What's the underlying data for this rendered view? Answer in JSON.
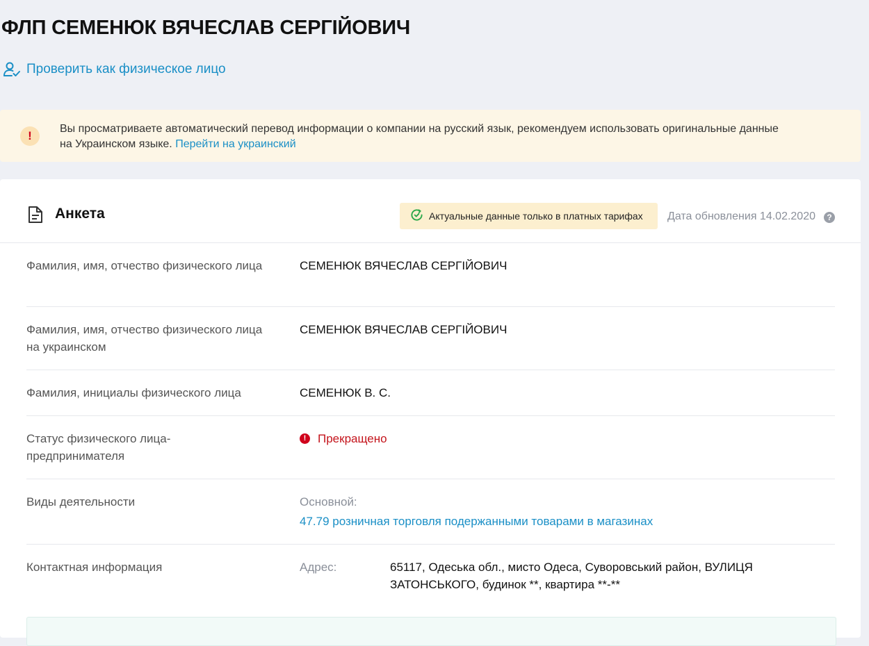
{
  "page": {
    "title": "ФЛП СЕМЕНЮК ВЯЧЕСЛАВ СЕРГІЙОВИЧ",
    "check_person_link": "Проверить как физическое лицо",
    "check_icon": "user-check-icon"
  },
  "notice": {
    "icon": "exclamation-icon",
    "line1": "Вы просматриваете автоматический перевод информации о компании на русский язык, рекомендуем использовать оригинальные данные",
    "line2": "на Украинском языке.",
    "link": "Перейти на украинский"
  },
  "card": {
    "title": "Анкета",
    "badge": "Актуальные данные только в платных тарифах",
    "update_date": "Дата обновления 14.02.2020",
    "help_icon_symbol": "?",
    "rows": [
      {
        "label": "Фамилия, имя, отчество физического лица",
        "value": "СЕМЕНЮК ВЯЧЕСЛАВ СЕРГІЙОВИЧ"
      },
      {
        "label": "Фамилия, имя, отчество физического лица на украинском",
        "value": "СЕМЕНЮК ВЯЧЕСЛАВ СЕРГІЙОВИЧ"
      },
      {
        "label": "Фамилия, инициалы физического лица",
        "value": "СЕМЕНЮК В. С."
      },
      {
        "label": "Статус физического лица-предпринимателя",
        "value": "Прекращено",
        "status_color": "#c4141c"
      },
      {
        "label": "Виды деятельности",
        "sublabel": "Основной:",
        "value": "47.79 розничная торговля подержанными товарами в магазинах"
      },
      {
        "label": "Контактная информация",
        "sublabel": "Адрес:",
        "value": "65117, Одеська обл., мисто Одеса, Суворовський район, ВУЛИЦЯ ЗАТОНСЬКОГО, будинок **, квартира **-**"
      }
    ]
  },
  "colors": {
    "accent_link": "#1a8fc6",
    "page_background": "#eef0f5",
    "notice_background": "#fdf6e6",
    "badge_background": "#fcefcf",
    "status_terminated": "#c4141c"
  }
}
